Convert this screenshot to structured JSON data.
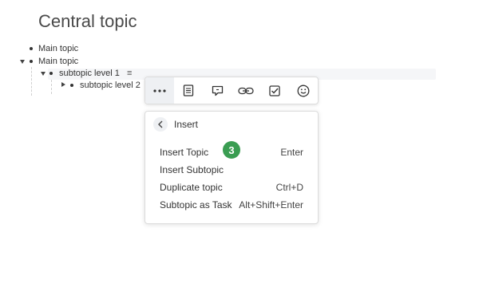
{
  "page_title": "Central topic",
  "outline": {
    "items": [
      {
        "label": "Main topic"
      },
      {
        "label": "Main topic"
      },
      {
        "label": "subtopic level 1"
      },
      {
        "label": "subtopic level 2"
      }
    ]
  },
  "toolbar": {
    "buttons": [
      {
        "icon": "more-horizontal-icon",
        "active": true
      },
      {
        "icon": "note-icon"
      },
      {
        "icon": "comment-icon"
      },
      {
        "icon": "link-icon"
      },
      {
        "icon": "checkbox-icon"
      },
      {
        "icon": "emoji-icon"
      }
    ]
  },
  "menu": {
    "header": "Insert",
    "items": [
      {
        "label": "Insert Topic",
        "shortcut": "Enter"
      },
      {
        "label": "Insert Subtopic",
        "shortcut": ""
      },
      {
        "label": "Duplicate topic",
        "shortcut": "Ctrl+D"
      },
      {
        "label": "Subtopic as Task",
        "shortcut": "Alt+Shift+Enter"
      }
    ]
  },
  "step_badge": "3",
  "colors": {
    "badge": "#3a9d52",
    "text": "#333333"
  }
}
